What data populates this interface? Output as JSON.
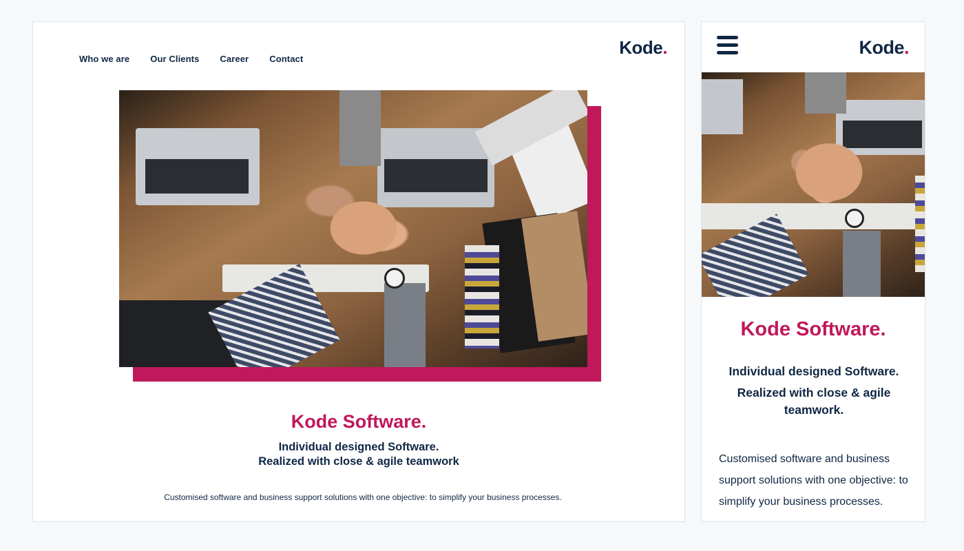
{
  "brand": {
    "name": "Kode",
    "dot": ".",
    "accent_color": "#c0185a",
    "text_color": "#0f2744"
  },
  "nav": {
    "items": [
      {
        "label": "Who we are"
      },
      {
        "label": "Our Clients"
      },
      {
        "label": "Career"
      },
      {
        "label": "Contact"
      }
    ]
  },
  "hero": {
    "title": "Kode Software.",
    "subtitle_line1": "Individual designed Software.",
    "subtitle_line2": "Realized with close & agile teamwork",
    "body": "Customised software and business support solutions with one objective: to simplify your business processes."
  },
  "mobile": {
    "menu_icon": "hamburger-icon",
    "subtitle_line1": "Individual designed Software.",
    "subtitle_line2": "Realized with close & agile teamwork.",
    "body": "Customised software and business support solutions with one objective: to simplify your business processes."
  }
}
